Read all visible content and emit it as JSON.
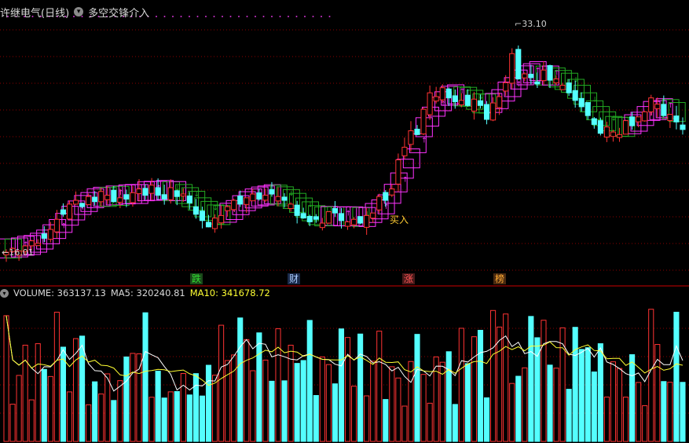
{
  "header": {
    "stock_title": "许继电气(日线)",
    "indicator_name": "多空交锋介入",
    "menu_icon": "chevron-down-icon"
  },
  "price_panel": {
    "high_label": "33.10",
    "low_label": "16.01",
    "buy_label": "买入",
    "event_tags": [
      {
        "text": "跌",
        "color": "#33dd33"
      },
      {
        "text": "财",
        "color": "#aaccff"
      },
      {
        "text": "涨",
        "color": "#ff5555"
      },
      {
        "text": "榜",
        "color": "#ffaa33"
      }
    ]
  },
  "volume_panel": {
    "volume_label": "VOLUME: 363137.13",
    "ma5_label": "MA5: 320240.81",
    "ma10_label": "MA10: 341678.72"
  },
  "colors": {
    "up": "#ff3333",
    "down": "#54ffff",
    "bull_band": "#ff33ff",
    "bear_band": "#22aa22",
    "ma5": "#ffffff",
    "ma10": "#ffff33",
    "grid": "#8b0000"
  },
  "chart_data": {
    "type": "candlestick",
    "y_range": [
      15.0,
      34.5
    ],
    "closes": [
      16.3,
      16.6,
      16.4,
      16.8,
      17.2,
      17.0,
      17.4,
      18.1,
      18.9,
      19.3,
      20.1,
      20.4,
      19.9,
      20.7,
      20.3,
      21.1,
      20.8,
      20.3,
      20.6,
      20.5,
      21.0,
      21.3,
      20.8,
      21.6,
      20.8,
      20.5,
      21.4,
      20.7,
      20.9,
      20.2,
      19.3,
      18.8,
      18.3,
      19.0,
      19.2,
      19.9,
      20.4,
      20.1,
      20.6,
      20.9,
      20.5,
      20.8,
      20.9,
      20.7,
      20.4,
      20.1,
      19.2,
      19.0,
      18.7,
      18.9,
      18.6,
      19.5,
      19.4,
      18.8,
      18.7,
      18.9,
      18.6,
      19.2,
      19.4,
      20.7,
      20.4,
      21.3,
      23.6,
      24.6,
      25.9,
      25.6,
      27.6,
      28.9,
      28.6,
      29.3,
      28.5,
      28.2,
      28.3,
      27.9,
      28.4,
      27.9,
      26.8,
      28.1,
      28.6,
      29.7,
      32.0,
      30.0,
      30.4,
      30.1,
      29.6,
      30.7,
      29.9,
      30.0,
      29.5,
      28.9,
      28.3,
      27.8,
      27.1,
      26.4,
      25.7,
      26.2,
      25.8,
      25.6,
      26.7,
      26.3,
      27.0,
      27.4,
      28.5,
      28.0,
      27.1,
      27.2,
      26.6,
      26.0
    ]
  }
}
